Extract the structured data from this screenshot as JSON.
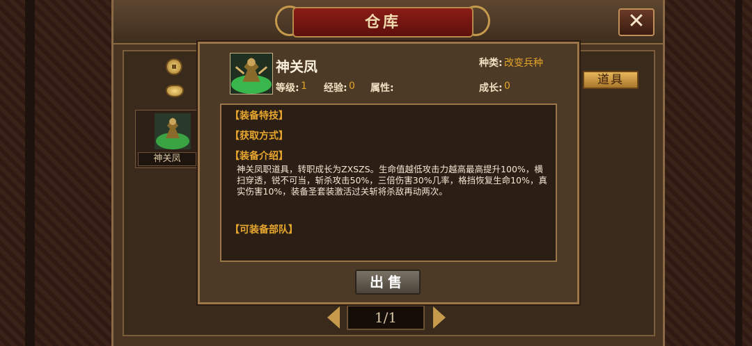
{
  "window": {
    "title": "仓库",
    "close_glyph": "✕"
  },
  "sidebar": {
    "coin_icon": "coin-icon",
    "ingot_icon": "gold-ingot-icon"
  },
  "tabs": {
    "items_label": "道具"
  },
  "inventory": {
    "slots": [
      {
        "name": "神关凤"
      }
    ]
  },
  "pager": {
    "text": "1/1"
  },
  "detail": {
    "name": "神关凤",
    "type_label": "种类:",
    "type_value": "改变兵种",
    "level_label": "等级:",
    "level_value": "1",
    "exp_label": "经验:",
    "exp_value": "0",
    "attr_label": "属性:",
    "growth_label": "成长:",
    "growth_value": "0",
    "sections": {
      "skill": "【装备特技】",
      "obtain": "【获取方式】",
      "intro": "【装备介绍】",
      "units": "【可装备部队】"
    },
    "description": "神关凤职道具，转职成长为ZXSZS。生命值越低攻击力越高最高提升100%，横扫穿透，锐不可当，斩杀攻击50%，三倍伤害30%几率，格挡恢复生命10%，真实伤害10%，装备圣套装激活过关斩将杀敌再动两次。",
    "sell_label": "出售"
  },
  "colors": {
    "accent_gold": "#e3a528",
    "title_red": "#8b1c16",
    "frame_brown": "#4a3522"
  }
}
